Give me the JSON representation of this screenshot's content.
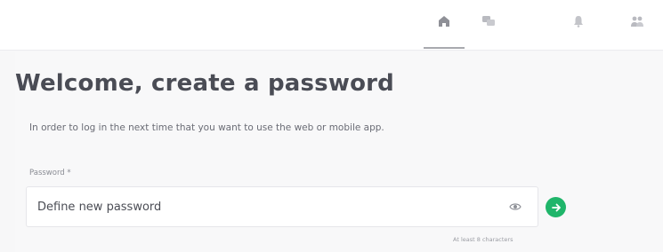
{
  "nav": {
    "items": [
      {
        "icon": "home-icon",
        "active": true
      },
      {
        "icon": "chat-icon",
        "active": false
      },
      {
        "icon": "bell-icon",
        "active": false
      },
      {
        "icon": "people-icon",
        "active": false
      }
    ]
  },
  "main": {
    "title": "Welcome, create a password",
    "subtitle": "In order to log in the next time that you want to use the web or mobile app.",
    "password": {
      "label": "Password *",
      "value": "",
      "placeholder": "Define new password",
      "hint": "At least 8 characters"
    }
  },
  "colors": {
    "accent": "#1fb56a",
    "title": "#4a4c55",
    "background": "#f7f7f8"
  }
}
